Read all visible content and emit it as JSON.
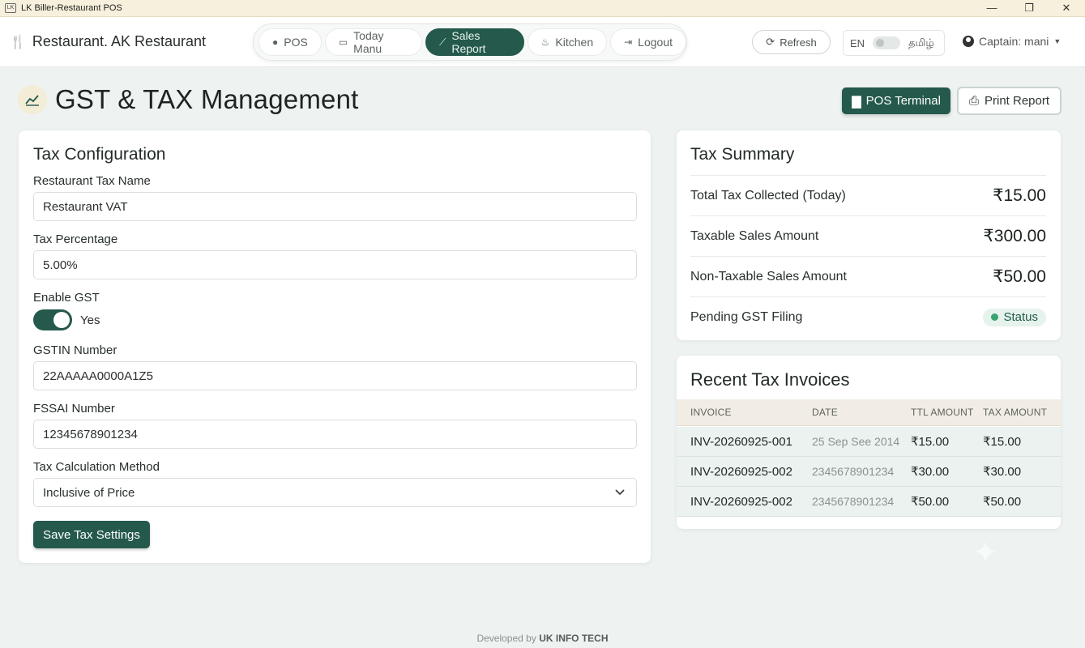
{
  "window": {
    "title": "LK Biller-Restaurant POS",
    "controls": [
      "—",
      "❐",
      "✕"
    ]
  },
  "header": {
    "brand": "Restaurant. AK Restaurant",
    "nav": [
      {
        "label": "POS",
        "icon": "bag-icon"
      },
      {
        "label": "Today Manu",
        "icon": "menu-card-icon"
      },
      {
        "label": "Sales Report",
        "icon": "chart-icon",
        "active": true
      },
      {
        "label": "Kitchen",
        "icon": "flame-icon"
      },
      {
        "label": "Logout",
        "icon": "logout-icon"
      }
    ],
    "refresh_label": "Refresh",
    "lang_label": "EN",
    "lang_alt": "தமிழ்",
    "user_label": "Captain: mani"
  },
  "page": {
    "title": "GST & TAX Management",
    "pos_terminal_label": "POS Terminal",
    "print_report_label": "Print Report"
  },
  "config": {
    "title": "Tax Configuration",
    "tax_name_label": "Restaurant Tax Name",
    "tax_name_value": "Restaurant VAT",
    "tax_pct_label": "Tax Percentage",
    "tax_pct_value": "5.00%",
    "gst_label": "Enable GST",
    "gst_value": "Yes",
    "gstin_label": "GSTIN Number",
    "gstin_value": "22AAAAA0000A1Z5",
    "fssai_label": "FSSAI Number",
    "fssai_value": "12345678901234",
    "method_label": "Tax Calculation Method",
    "method_value": "Inclusive of Price",
    "save_label": "Save Tax Settings"
  },
  "summary": {
    "title": "Tax Summary",
    "rows": [
      {
        "label": "Total Tax Collected (Today)",
        "value": "₹15.00"
      },
      {
        "label": "Taxable Sales Amount",
        "value": "₹300.00"
      },
      {
        "label": "Non-Taxable Sales Amount",
        "value": "₹50.00"
      }
    ],
    "pending_label": "Pending GST Filing",
    "pending_status": "Status"
  },
  "invoices": {
    "title": "Recent Tax Invoices",
    "columns": [
      "INVOICE",
      "DATE",
      "TTL AMOUNT",
      "TAX AMOUNT"
    ],
    "rows": [
      {
        "invoice": "INV-20260925-001",
        "date": "25 Sep See 2014",
        "total": "₹15.00",
        "tax": "₹15.00"
      },
      {
        "invoice": "INV-20260925-002",
        "date": "2345678901234",
        "total": "₹30.00",
        "tax": "₹30.00"
      },
      {
        "invoice": "INV-20260925-002",
        "date": "2345678901234",
        "total": "₹50.00",
        "tax": "₹50.00"
      }
    ]
  },
  "footer": {
    "prefix": "Developed by",
    "company": "UK INFO TECH"
  },
  "colors": {
    "accent": "#24594c",
    "background": "#eef3f1",
    "status_dot": "#3aa572"
  }
}
